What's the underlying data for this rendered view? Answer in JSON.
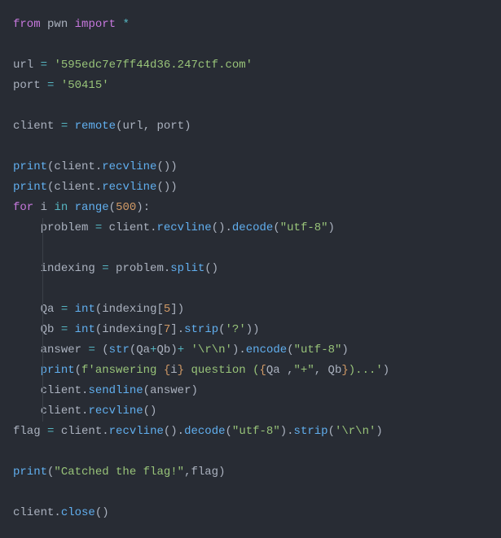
{
  "code": {
    "l1": {
      "from": "from",
      "pwn": "pwn",
      "import": "import",
      "star": "*"
    },
    "l3": {
      "url_var": "url",
      "eq": "=",
      "url_val": "'595edc7e7ff44d36.247ctf.com'"
    },
    "l4": {
      "port_var": "port",
      "eq": "=",
      "port_val": "'50415'"
    },
    "l6": {
      "client_var": "client",
      "eq": "=",
      "remote": "remote",
      "lp": "(",
      "url": "url",
      "comma": ",",
      "port": "port",
      "rp": ")"
    },
    "l8": {
      "print": "print",
      "lp": "(",
      "client": "client",
      "dot": ".",
      "recvline": "recvline",
      "call": "())"
    },
    "l9": {
      "print": "print",
      "lp": "(",
      "client": "client",
      "dot": ".",
      "recvline": "recvline",
      "call": "())"
    },
    "l10": {
      "for": "for",
      "i": "i",
      "in": "in",
      "range": "range",
      "lp": "(",
      "n": "500",
      "rp": "):"
    },
    "l11": {
      "indent": "    ",
      "problem": "problem",
      "eq": "=",
      "client": "client",
      "dot": ".",
      "recvline": "recvline",
      "call1": "().",
      "decode": "decode",
      "lp": "(",
      "utf": "\"utf-8\"",
      "rp": ")"
    },
    "l13": {
      "indent": "    ",
      "indexing": "indexing",
      "eq": "=",
      "problem": "problem",
      "dot": ".",
      "split": "split",
      "call": "()"
    },
    "l15": {
      "indent": "    ",
      "qa": "Qa",
      "eq": "=",
      "int": "int",
      "lp": "(",
      "indexing": "indexing",
      "lb": "[",
      "n": "5",
      "rb": "])"
    },
    "l16": {
      "indent": "    ",
      "qb": "Qb",
      "eq": "=",
      "int": "int",
      "lp": "(",
      "indexing": "indexing",
      "lb": "[",
      "n": "7",
      "rb": "].",
      "strip": "strip",
      "lp2": "(",
      "q": "'?'",
      "rp2": "))"
    },
    "l17": {
      "indent": "    ",
      "answer": "answer",
      "eq": "=",
      "lp": "(",
      "str": "str",
      "lp2": "(",
      "qa": "Qa",
      "plus": "+",
      "qb": "Qb",
      "rp2": ")",
      "plus2": "+",
      "rn": "'\\r\\n'",
      "rp": ").",
      "encode": "encode",
      "lp3": "(",
      "utf": "\"utf-8\"",
      "rp3": ")"
    },
    "l18": {
      "indent": "    ",
      "print": "print",
      "lp": "(",
      "f": "f'answering ",
      "lb1": "{",
      "i": "i",
      "rb1": "}",
      "mid": " question (",
      "lb2": "{",
      "qa": "Qa ",
      "c1": ",",
      "plus": "\"+\"",
      "c2": ",",
      "qb": " Qb",
      "rb2": "}",
      "end": ")...'",
      "rp": ")"
    },
    "l19": {
      "indent": "    ",
      "client": "client",
      "dot": ".",
      "sendline": "sendline",
      "lp": "(",
      "answer": "answer",
      "rp": ")"
    },
    "l20": {
      "indent": "    ",
      "client": "client",
      "dot": ".",
      "recvline": "recvline",
      "call": "()"
    },
    "l21": {
      "flag": "flag",
      "eq": "=",
      "client": "client",
      "dot": ".",
      "recvline": "recvline",
      "call": "().",
      "decode": "decode",
      "lp": "(",
      "utf": "\"utf-8\"",
      "rp": ").",
      "strip": "strip",
      "lp2": "(",
      "rn": "'\\r\\n'",
      "rp2": ")"
    },
    "l23": {
      "print": "print",
      "lp": "(",
      "msg": "\"Catched the flag!\"",
      "comma": ",",
      "flag": "flag",
      "rp": ")"
    },
    "l25": {
      "client": "client",
      "dot": ".",
      "close": "close",
      "call": "()"
    }
  }
}
